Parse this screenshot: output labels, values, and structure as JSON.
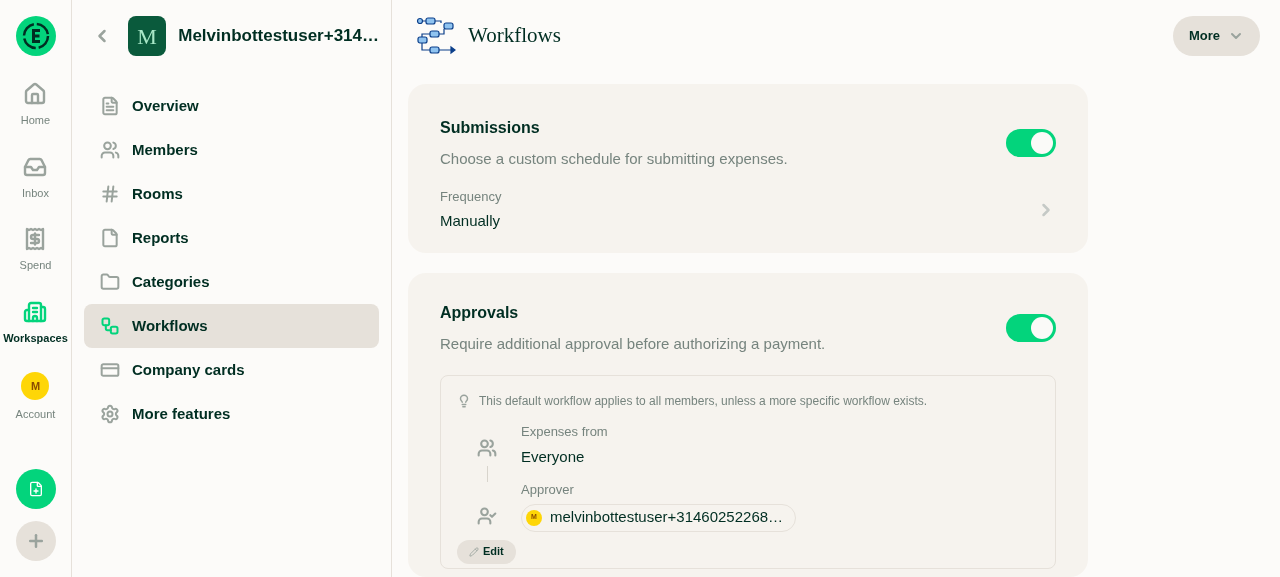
{
  "nav_rail": [
    {
      "label": "Home",
      "selected": false
    },
    {
      "label": "Inbox",
      "selected": false
    },
    {
      "label": "Spend",
      "selected": false
    },
    {
      "label": "Workspaces",
      "selected": true
    },
    {
      "label": "Account",
      "avatar_letter": "M",
      "selected": false
    }
  ],
  "workspace": {
    "avatar_letter": "M",
    "name": "Melvinbottestuser+314…"
  },
  "menu": [
    {
      "label": "Overview",
      "selected": false
    },
    {
      "label": "Members",
      "selected": false
    },
    {
      "label": "Rooms",
      "selected": false
    },
    {
      "label": "Reports",
      "selected": false
    },
    {
      "label": "Categories",
      "selected": false
    },
    {
      "label": "Workflows",
      "selected": true
    },
    {
      "label": "Company cards",
      "selected": false
    },
    {
      "label": "More features",
      "selected": false
    }
  ],
  "header": {
    "title": "Workflows",
    "more_button": "More"
  },
  "submissions": {
    "title": "Submissions",
    "description": "Choose a custom schedule for submitting expenses.",
    "on": true,
    "frequency_label": "Frequency",
    "frequency_value": "Manually"
  },
  "approvals": {
    "title": "Approvals",
    "description": "Require additional approval before authorizing a payment.",
    "on": true,
    "hint": "This default workflow applies to all members, unless a more specific workflow exists.",
    "expenses_from_label": "Expenses from",
    "expenses_from_value": "Everyone",
    "approver_label": "Approver",
    "approver_avatar_letter": "M",
    "approver_name": "melvinbottestuser+31460252268…",
    "edit_button": "Edit"
  }
}
